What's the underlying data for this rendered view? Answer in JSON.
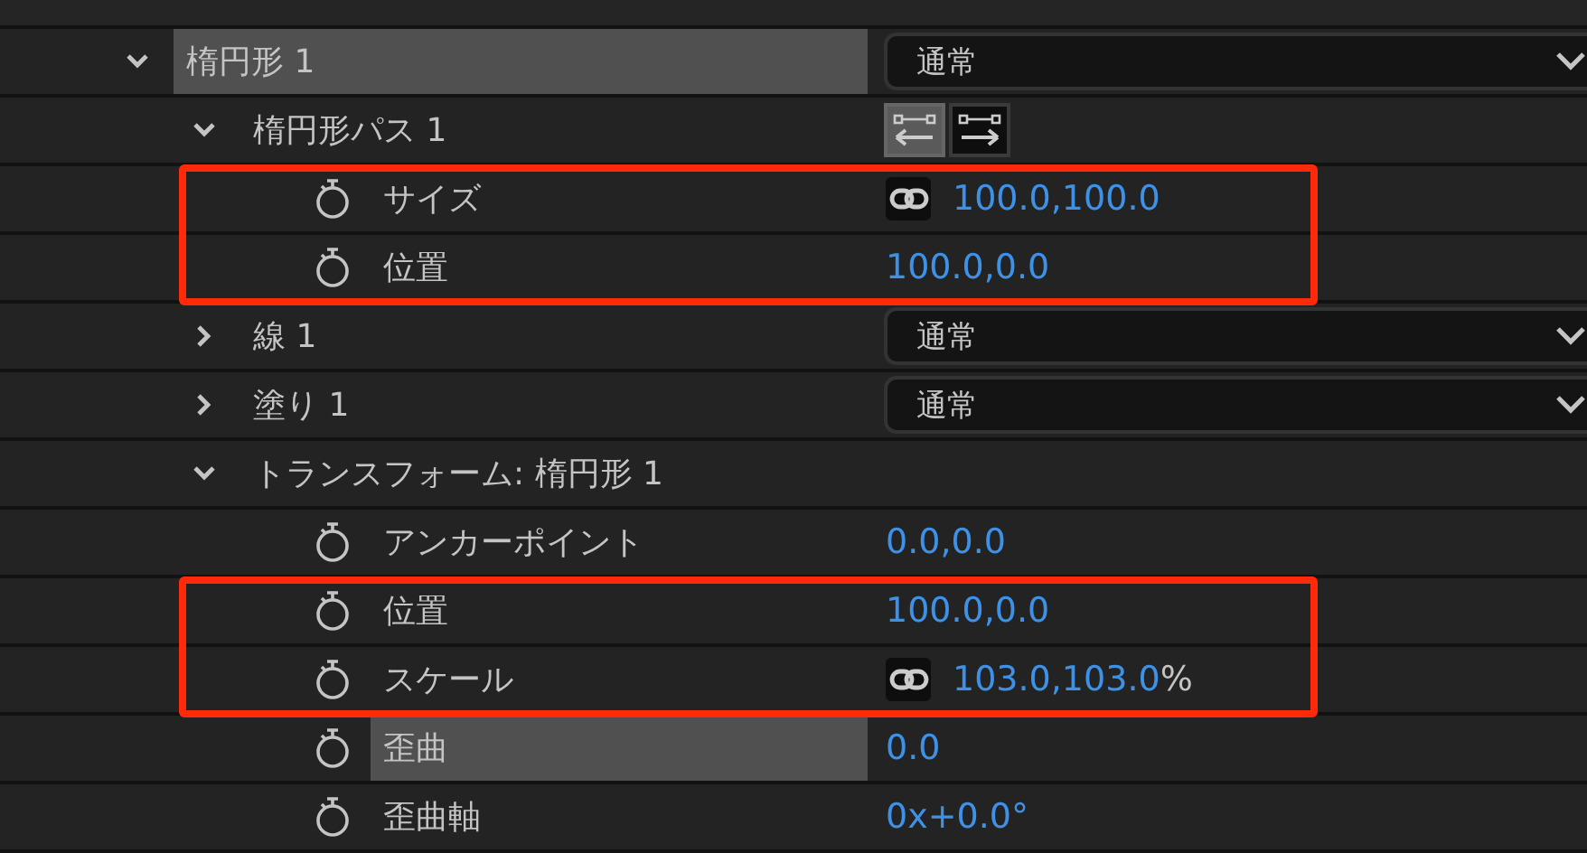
{
  "layers": [
    {
      "kind": "group",
      "name": "楕円形 1",
      "expanded": true,
      "selected": true,
      "blend": "通常",
      "children": [
        {
          "kind": "path",
          "name": "楕円形パス 1",
          "expanded": true,
          "selected": false,
          "direction_buttons": [
            {
              "selected": true
            },
            {
              "selected": false
            }
          ],
          "children": [
            {
              "kind": "property",
              "name": "サイズ",
              "selected": false,
              "highlighted": true,
              "linked": true,
              "value": "100.0,100.0"
            },
            {
              "kind": "property",
              "name": "位置",
              "selected": false,
              "highlighted": true,
              "linked": false,
              "value": "100.0,0.0"
            }
          ]
        },
        {
          "kind": "group",
          "name": "線 1",
          "expanded": false,
          "selected": false,
          "blend": "通常"
        },
        {
          "kind": "group",
          "name": "塗り 1",
          "expanded": false,
          "selected": false,
          "blend": "通常"
        },
        {
          "kind": "transform",
          "name": "トランスフォーム: 楕円形 1",
          "expanded": true,
          "selected": false,
          "children": [
            {
              "kind": "property",
              "name": "アンカーポイント",
              "selected": false,
              "highlighted": false,
              "linked": false,
              "value": "0.0,0.0"
            },
            {
              "kind": "property",
              "name": "位置",
              "selected": false,
              "highlighted": true,
              "linked": false,
              "value": "100.0,0.0"
            },
            {
              "kind": "property",
              "name": "スケール",
              "selected": false,
              "highlighted": true,
              "linked": true,
              "value": "103.0,103.0",
              "unit": "%"
            },
            {
              "kind": "property",
              "name": "歪曲",
              "selected": true,
              "highlighted": false,
              "linked": false,
              "value": "0.0"
            },
            {
              "kind": "property",
              "name": "歪曲軸",
              "selected": false,
              "highlighted": false,
              "linked": false,
              "value": "0x+0.0°"
            }
          ]
        }
      ]
    }
  ]
}
